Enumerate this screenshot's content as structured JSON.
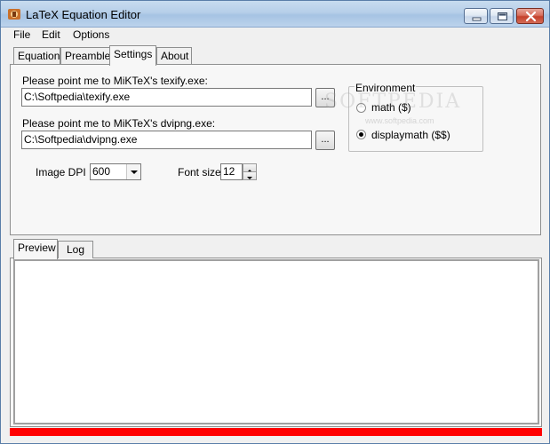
{
  "window": {
    "title": "LaTeX Equation Editor"
  },
  "menu": {
    "items": [
      "File",
      "Edit",
      "Options"
    ]
  },
  "top_tabs": [
    {
      "label": "Equation",
      "active": false
    },
    {
      "label": "Preamble",
      "active": false
    },
    {
      "label": "Settings",
      "active": true
    },
    {
      "label": "About",
      "active": false
    }
  ],
  "settings": {
    "texify_label": "Please point me to MiKTeX's texify.exe:",
    "texify_path": "C:\\Softpedia\\texify.exe",
    "dvipng_label": "Please point me to MiKTeX's dvipng.exe:",
    "dvipng_path": "C:\\Softpedia\\dvipng.exe",
    "browse_label": "...",
    "image_dpi_label": "Image DPI",
    "image_dpi_value": "600",
    "font_size_label": "Font size",
    "font_size_value": "12",
    "environment": {
      "title": "Environment",
      "options": [
        {
          "label": "math ($)",
          "checked": false
        },
        {
          "label": "displaymath ($$)",
          "checked": true
        }
      ]
    }
  },
  "bottom_tabs": [
    {
      "label": "Preview",
      "active": true
    },
    {
      "label": "Log",
      "active": false
    }
  ],
  "watermark": {
    "main": "SOFTPEDIA",
    "sub": "www.softpedia.com"
  },
  "colors": {
    "progress_bar": "#ff0000",
    "close_button": "#c4402b"
  }
}
